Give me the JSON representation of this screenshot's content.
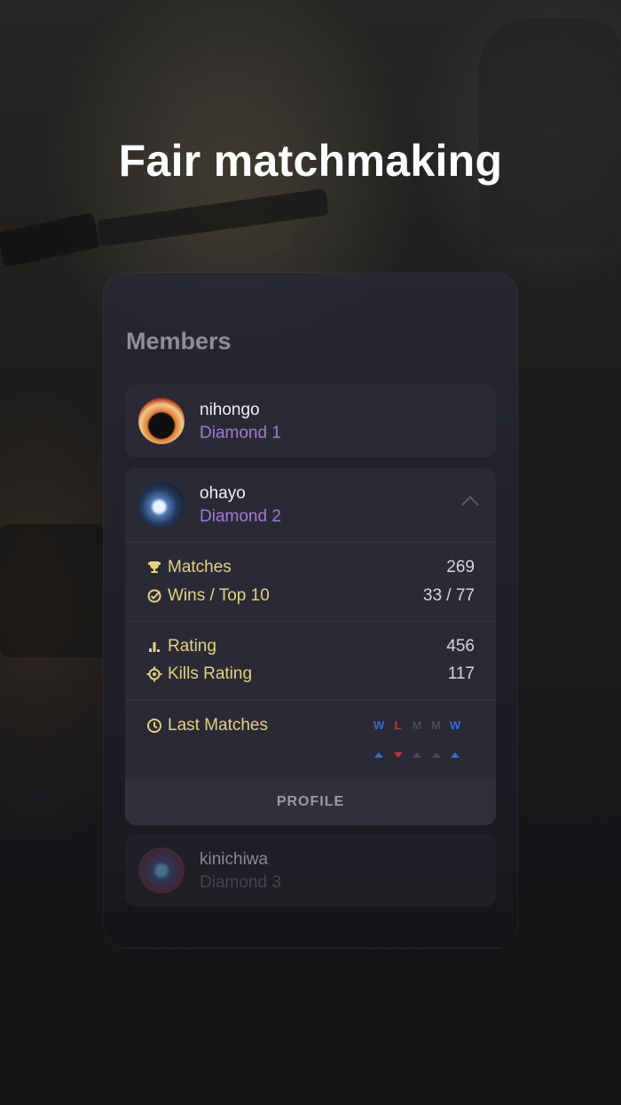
{
  "headline": "Fair matchmaking",
  "members_section": {
    "title": "Members",
    "members": [
      {
        "name": "nihongo",
        "rank": "Diamond 1"
      },
      {
        "name": "ohayo",
        "rank": "Diamond 2",
        "expanded": true,
        "stats": [
          {
            "icon": "trophy-icon",
            "label": "Matches",
            "value": "269"
          },
          {
            "icon": "check-circle-icon",
            "label": "Wins / Top 10",
            "value": "33 / 77"
          },
          {
            "icon": "bar-chart-icon",
            "label": "Rating",
            "value": "456"
          },
          {
            "icon": "crosshair-icon",
            "label": "Kills Rating",
            "value": "117"
          }
        ],
        "last_matches_label": "Last Matches",
        "last_matches": [
          {
            "result": "W",
            "trend": "up",
            "color": "#2f6fd1"
          },
          {
            "result": "L",
            "trend": "down",
            "color": "#c9342f"
          },
          {
            "result": "M",
            "trend": "up",
            "color": "#4a4a55"
          },
          {
            "result": "M",
            "trend": "up",
            "color": "#4a4a55"
          },
          {
            "result": "W",
            "trend": "up",
            "color": "#2f6fd1"
          }
        ],
        "profile_button": "PROFILE"
      },
      {
        "name": "kinichiwa",
        "rank": "Diamond 3"
      }
    ]
  },
  "colors": {
    "rank": "#a17ad6",
    "stat_label": "#e4d27c",
    "win": "#2f6fd1",
    "loss": "#c9342f"
  }
}
